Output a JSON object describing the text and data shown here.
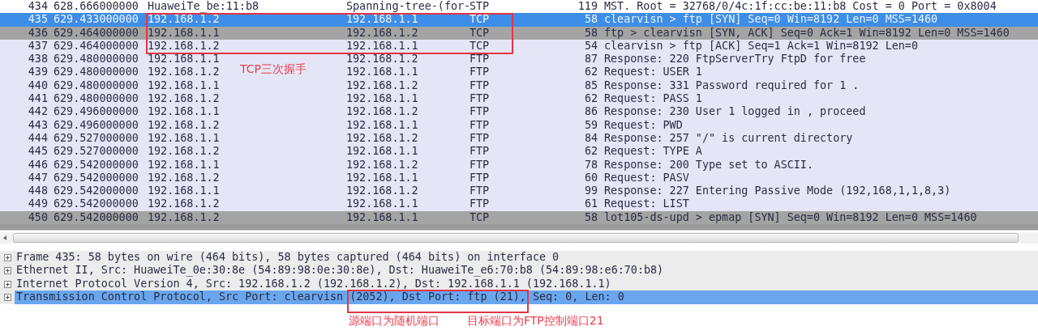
{
  "packet_list": {
    "rows": [
      {
        "no": "434",
        "time": "628.666000000",
        "source": "HuaweiTe_be:11:b8",
        "destination": "Spanning-tree-(for-",
        "protocol": "STP",
        "length": "119",
        "info": "MST. Root = 32768/0/4c:1f:cc:be:11:b8  Cost = 0  Port = 0x8004",
        "selected": false,
        "color": "#ffffff"
      },
      {
        "no": "435",
        "time": "629.433000000",
        "source": "192.168.1.2",
        "destination": "192.168.1.1",
        "protocol": "TCP",
        "length": "58",
        "info": "clearvisn > ftp [SYN] Seq=0 Win=8192 Len=0 MSS=1460",
        "selected": true,
        "color": "#3d8ee8"
      },
      {
        "no": "436",
        "time": "629.464000000",
        "source": "192.168.1.1",
        "destination": "192.168.1.2",
        "protocol": "TCP",
        "length": "58",
        "info": "ftp > clearvisn [SYN, ACK] Seq=0 Ack=1 Win=8192 Len=0 MSS=1460",
        "selected": false,
        "color": "#a4a4a4"
      },
      {
        "no": "437",
        "time": "629.464000000",
        "source": "192.168.1.2",
        "destination": "192.168.1.1",
        "protocol": "TCP",
        "length": "54",
        "info": "clearvisn > ftp [ACK] Seq=1 Ack=1 Win=8192 Len=0",
        "selected": false,
        "color": "#e4e6f7"
      },
      {
        "no": "438",
        "time": "629.480000000",
        "source": "192.168.1.1",
        "destination": "192.168.1.2",
        "protocol": "FTP",
        "length": "87",
        "info": "Response: 220 FtpServerTry FtpD for free",
        "selected": false,
        "color": "#e4e6f7"
      },
      {
        "no": "439",
        "time": "629.480000000",
        "source": "192.168.1.2",
        "destination": "192.168.1.1",
        "protocol": "FTP",
        "length": "62",
        "info": "Request: USER 1",
        "selected": false,
        "color": "#e4e6f7"
      },
      {
        "no": "440",
        "time": "629.480000000",
        "source": "192.168.1.1",
        "destination": "192.168.1.2",
        "protocol": "FTP",
        "length": "85",
        "info": "Response: 331 Password required for 1 .",
        "selected": false,
        "color": "#e4e6f7"
      },
      {
        "no": "441",
        "time": "629.480000000",
        "source": "192.168.1.2",
        "destination": "192.168.1.1",
        "protocol": "FTP",
        "length": "62",
        "info": "Request: PASS 1",
        "selected": false,
        "color": "#e4e6f7"
      },
      {
        "no": "442",
        "time": "629.496000000",
        "source": "192.168.1.1",
        "destination": "192.168.1.2",
        "protocol": "FTP",
        "length": "86",
        "info": "Response: 230 User 1 logged in , proceed",
        "selected": false,
        "color": "#e4e6f7"
      },
      {
        "no": "443",
        "time": "629.496000000",
        "source": "192.168.1.2",
        "destination": "192.168.1.1",
        "protocol": "FTP",
        "length": "59",
        "info": "Request: PWD",
        "selected": false,
        "color": "#e4e6f7"
      },
      {
        "no": "444",
        "time": "629.527000000",
        "source": "192.168.1.1",
        "destination": "192.168.1.2",
        "protocol": "FTP",
        "length": "84",
        "info": "Response: 257 \"/\" is current directory",
        "selected": false,
        "color": "#e4e6f7"
      },
      {
        "no": "445",
        "time": "629.527000000",
        "source": "192.168.1.2",
        "destination": "192.168.1.1",
        "protocol": "FTP",
        "length": "62",
        "info": "Request: TYPE A",
        "selected": false,
        "color": "#e4e6f7"
      },
      {
        "no": "446",
        "time": "629.542000000",
        "source": "192.168.1.1",
        "destination": "192.168.1.2",
        "protocol": "FTP",
        "length": "78",
        "info": "Response: 200 Type set to ASCII.",
        "selected": false,
        "color": "#e4e6f7"
      },
      {
        "no": "447",
        "time": "629.542000000",
        "source": "192.168.1.2",
        "destination": "192.168.1.1",
        "protocol": "FTP",
        "length": "60",
        "info": "Request: PASV",
        "selected": false,
        "color": "#e4e6f7"
      },
      {
        "no": "448",
        "time": "629.542000000",
        "source": "192.168.1.1",
        "destination": "192.168.1.2",
        "protocol": "FTP",
        "length": "99",
        "info": "Response: 227 Entering Passive Mode (192,168,1,1,8,3)",
        "selected": false,
        "color": "#e4e6f7"
      },
      {
        "no": "449",
        "time": "629.542000000",
        "source": "192.168.1.2",
        "destination": "192.168.1.1",
        "protocol": "FTP",
        "length": "61",
        "info": "Request: LIST",
        "selected": false,
        "color": "#e4e6f7"
      },
      {
        "no": "450",
        "time": "629.542000000",
        "source": "192.168.1.2",
        "destination": "192.168.1.1",
        "protocol": "TCP",
        "length": "58",
        "info": "lot105-ds-upd > epmap [SYN] Seq=0 Win=8192 Len=0 MSS=1460",
        "selected": false,
        "color": "#a4a4a4"
      }
    ]
  },
  "packet_details": [
    {
      "text": "Frame 435: 58 bytes on wire (464 bits), 58 bytes captured (464 bits) on interface 0",
      "expanded": false,
      "selected": false
    },
    {
      "text": "Ethernet II, Src: HuaweiTe_0e:30:8e (54:89:98:0e:30:8e), Dst: HuaweiTe_e6:70:b8 (54:89:98:e6:70:b8)",
      "expanded": false,
      "selected": false
    },
    {
      "text": "Internet Protocol Version 4, Src: 192.168.1.2 (192.168.1.2), Dst: 192.168.1.1 (192.168.1.1)",
      "expanded": false,
      "selected": false
    },
    {
      "text": "Transmission Control Protocol, Src Port: clearvisn (2052), Dst Port: ftp (21), Seq: 0, Len: 0",
      "expanded": false,
      "selected": true
    }
  ],
  "annotations": [
    {
      "text": "TCP三次握手"
    },
    {
      "text": "源端口为随机端口"
    },
    {
      "text": "目标端口为FTP控制端口21"
    }
  ]
}
